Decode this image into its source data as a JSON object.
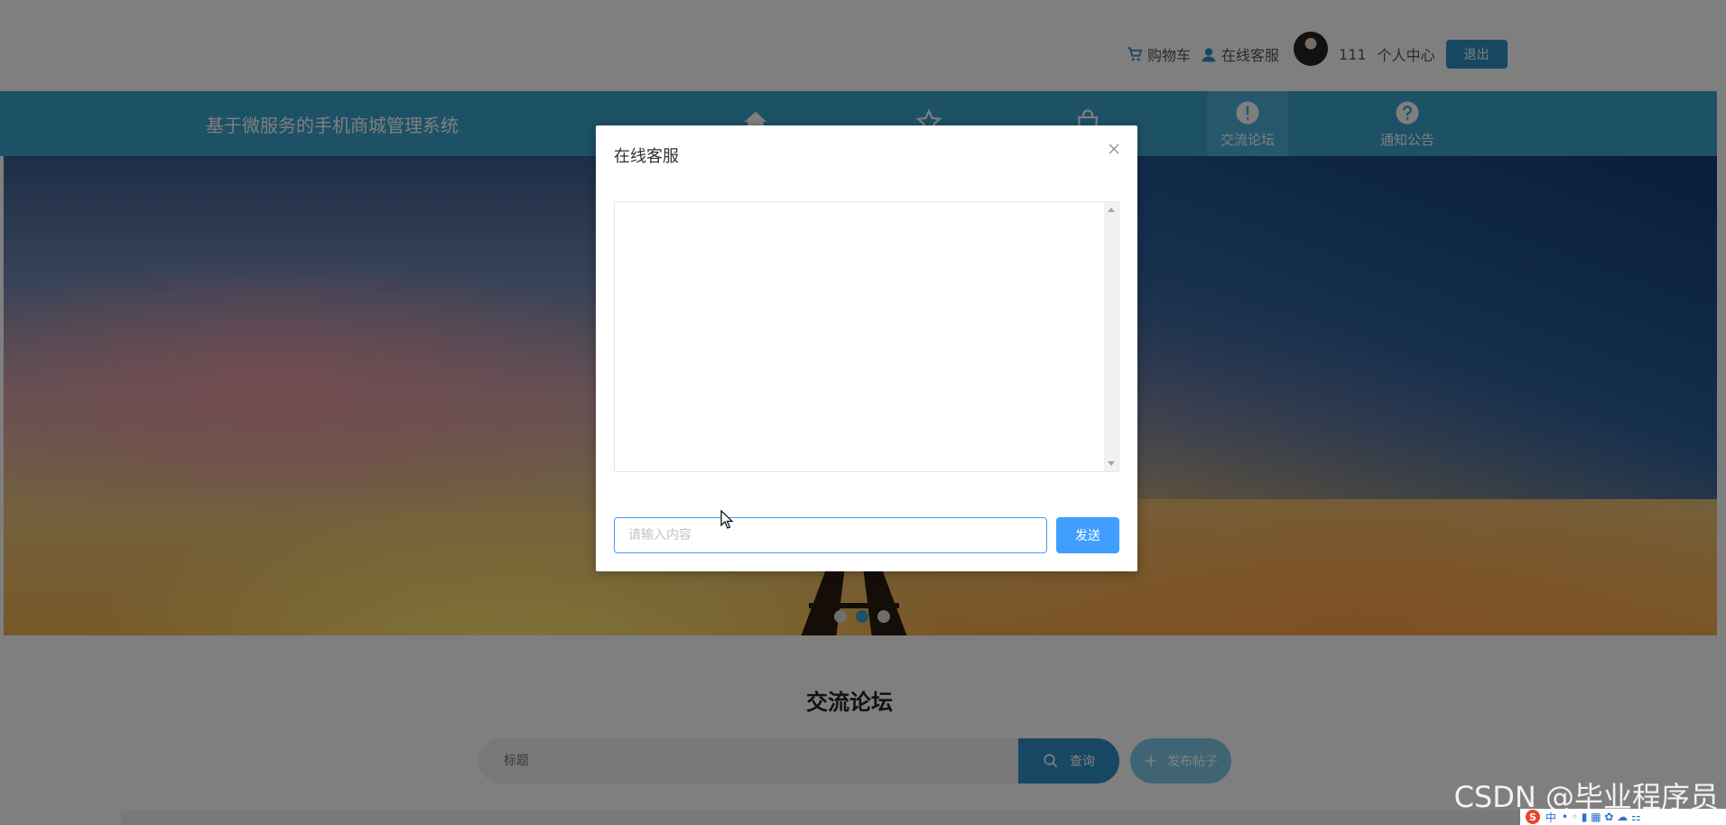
{
  "header": {
    "cart_label": "购物车",
    "service_label": "在线客服",
    "username": "111",
    "profile_label": "个人中心",
    "logout_label": "退出"
  },
  "nav": {
    "site_title": "基于微服务的手机商城管理系统",
    "items": [
      {
        "label": "",
        "icon": "home-icon"
      },
      {
        "label": "",
        "icon": "star-icon"
      },
      {
        "label": "",
        "icon": "shopping-bag-icon"
      },
      {
        "label": "交流论坛",
        "icon": "exclamation-icon",
        "active": true
      },
      {
        "label": "通知公告",
        "icon": "question-icon"
      }
    ]
  },
  "banner": {
    "slide_count": 3,
    "active_slide": 2
  },
  "forum": {
    "title": "交流论坛",
    "search_placeholder": "标题",
    "search_label": "查询",
    "post_label": "发布帖子"
  },
  "dialog": {
    "title": "在线客服",
    "input_placeholder": "请输入内容",
    "send_label": "发送"
  },
  "watermark": {
    "text": "CSDN @毕业程序员",
    "tray_text": "中"
  },
  "colors": {
    "nav_bg": "#3aa2cd",
    "primary": "#409eff",
    "logout_bg": "#2e8fc7"
  }
}
